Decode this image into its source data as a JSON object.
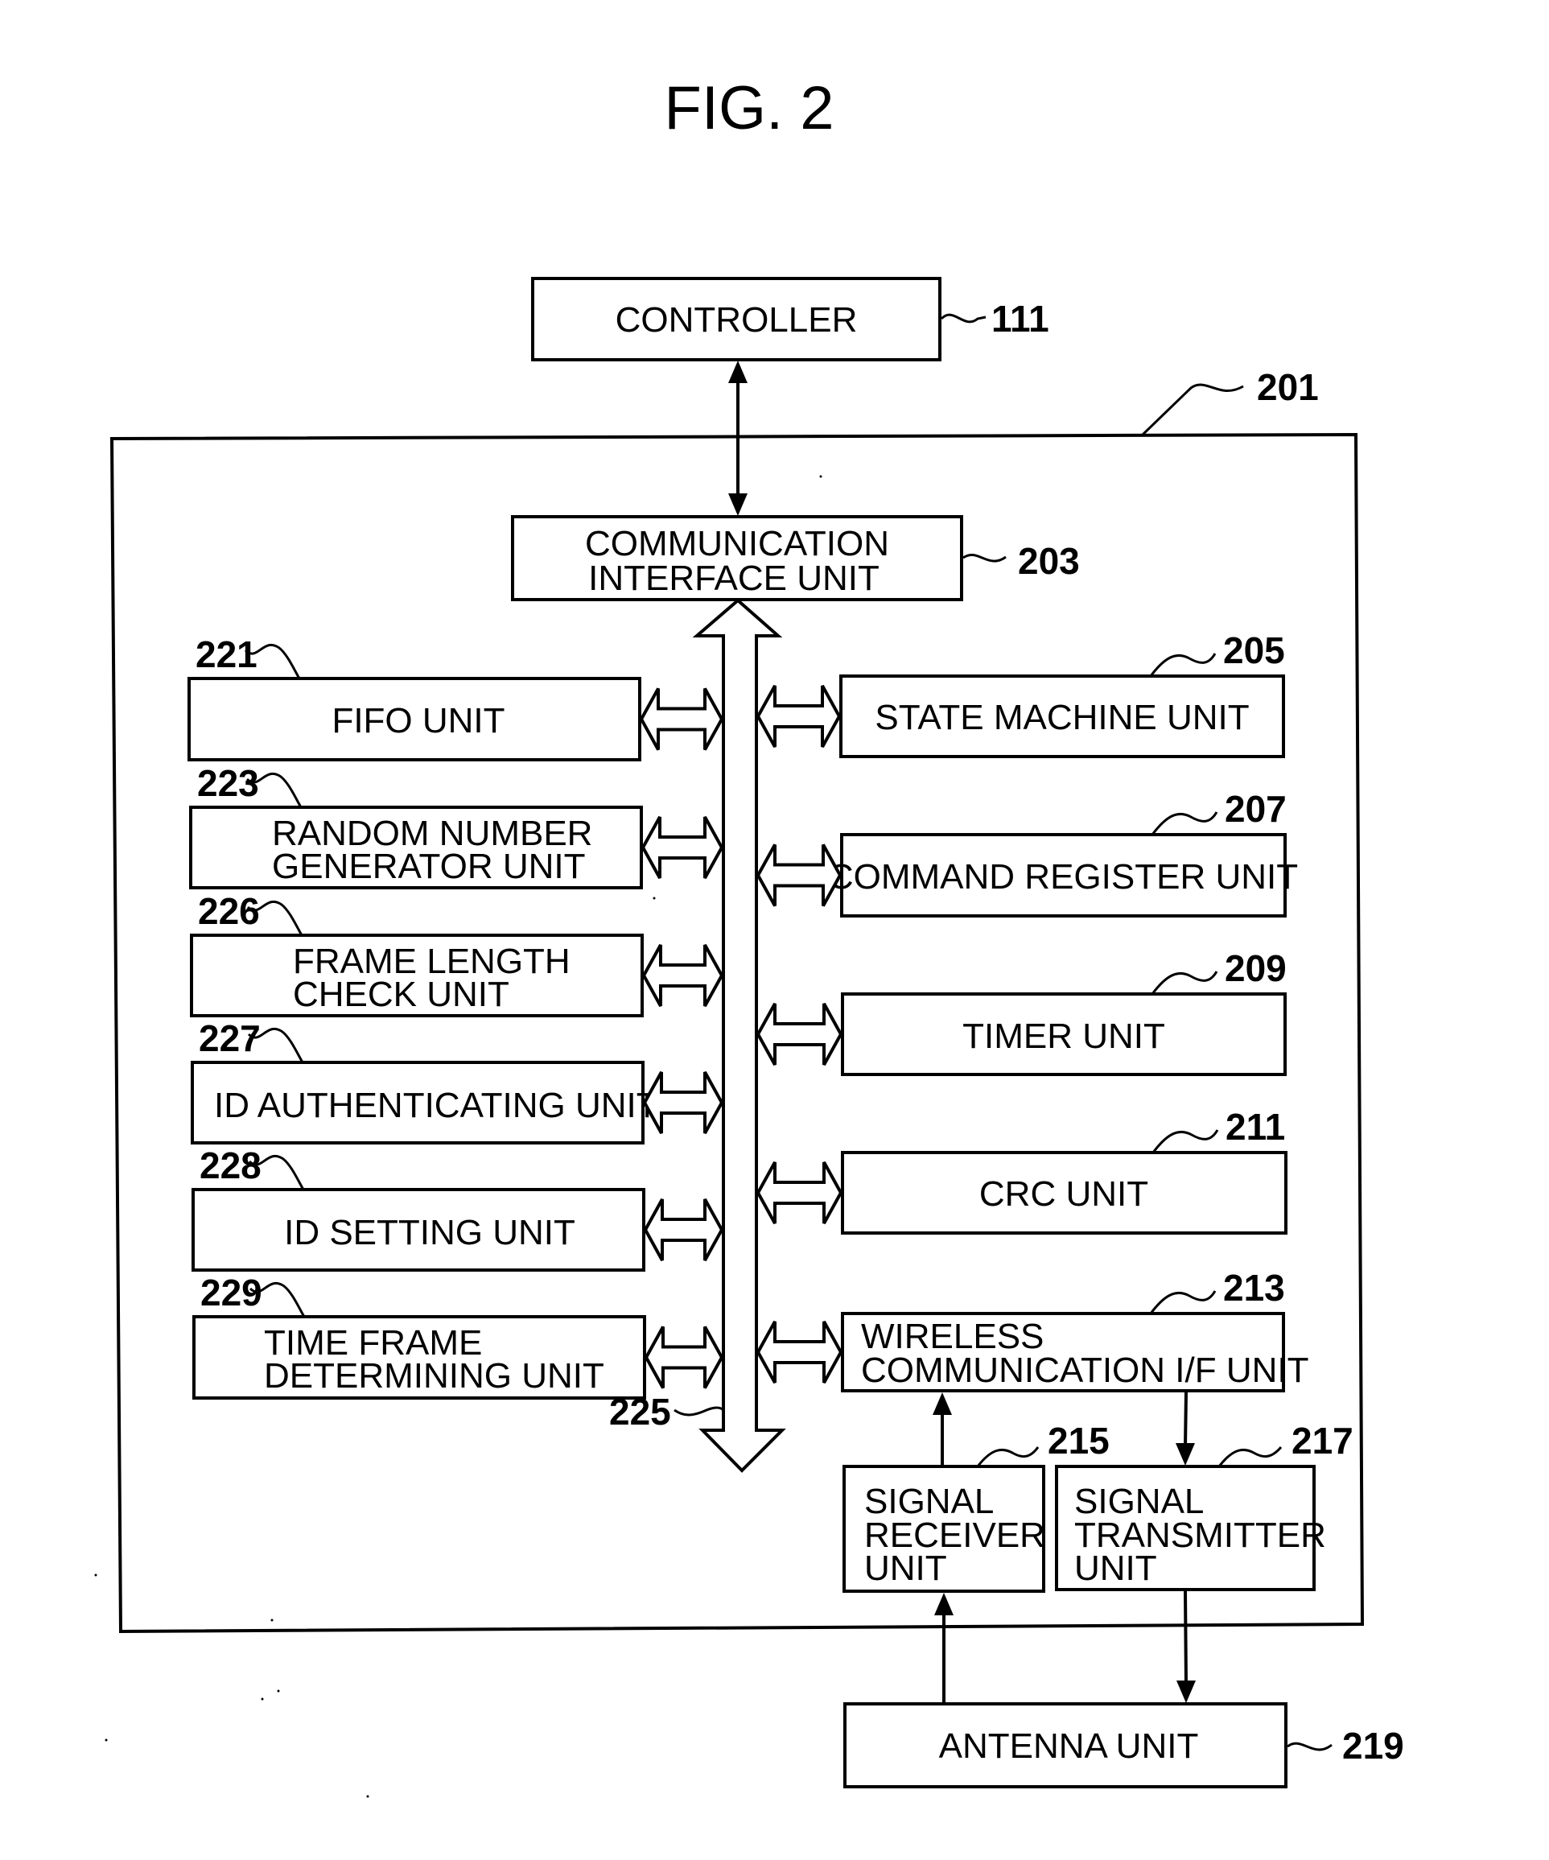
{
  "figure": {
    "title": "FIG. 2"
  },
  "controller": {
    "label": "CONTROLLER",
    "ref": "111"
  },
  "device": {
    "ref": "201"
  },
  "comm_interface": {
    "lines": [
      "COMMUNICATION",
      "INTERFACE UNIT"
    ],
    "ref": "203"
  },
  "bus": {
    "ref": "225"
  },
  "left_units": [
    {
      "ref": "221",
      "lines": [
        "FIFO UNIT"
      ]
    },
    {
      "ref": "223",
      "lines": [
        "RANDOM NUMBER",
        "GENERATOR UNIT"
      ]
    },
    {
      "ref": "226",
      "lines": [
        "FRAME LENGTH",
        "CHECK UNIT"
      ]
    },
    {
      "ref": "227",
      "lines": [
        "ID AUTHENTICATING UNIT"
      ]
    },
    {
      "ref": "228",
      "lines": [
        "ID SETTING UNIT"
      ]
    },
    {
      "ref": "229",
      "lines": [
        "TIME FRAME",
        "DETERMINING UNIT"
      ]
    }
  ],
  "right_units": [
    {
      "ref": "205",
      "lines": [
        "STATE MACHINE UNIT"
      ]
    },
    {
      "ref": "207",
      "lines": [
        "COMMAND REGISTER UNIT"
      ]
    },
    {
      "ref": "209",
      "lines": [
        "TIMER UNIT"
      ]
    },
    {
      "ref": "211",
      "lines": [
        "CRC UNIT"
      ]
    },
    {
      "ref": "213",
      "lines": [
        "WIRELESS",
        "COMMUNICATION I/F UNIT"
      ]
    }
  ],
  "receiver": {
    "lines": [
      "SIGNAL",
      "RECEIVER",
      "UNIT"
    ],
    "ref": "215"
  },
  "transmitter": {
    "lines": [
      "SIGNAL",
      "TRANSMITTER",
      "UNIT"
    ],
    "ref": "217"
  },
  "antenna": {
    "label": "ANTENNA UNIT",
    "ref": "219"
  }
}
